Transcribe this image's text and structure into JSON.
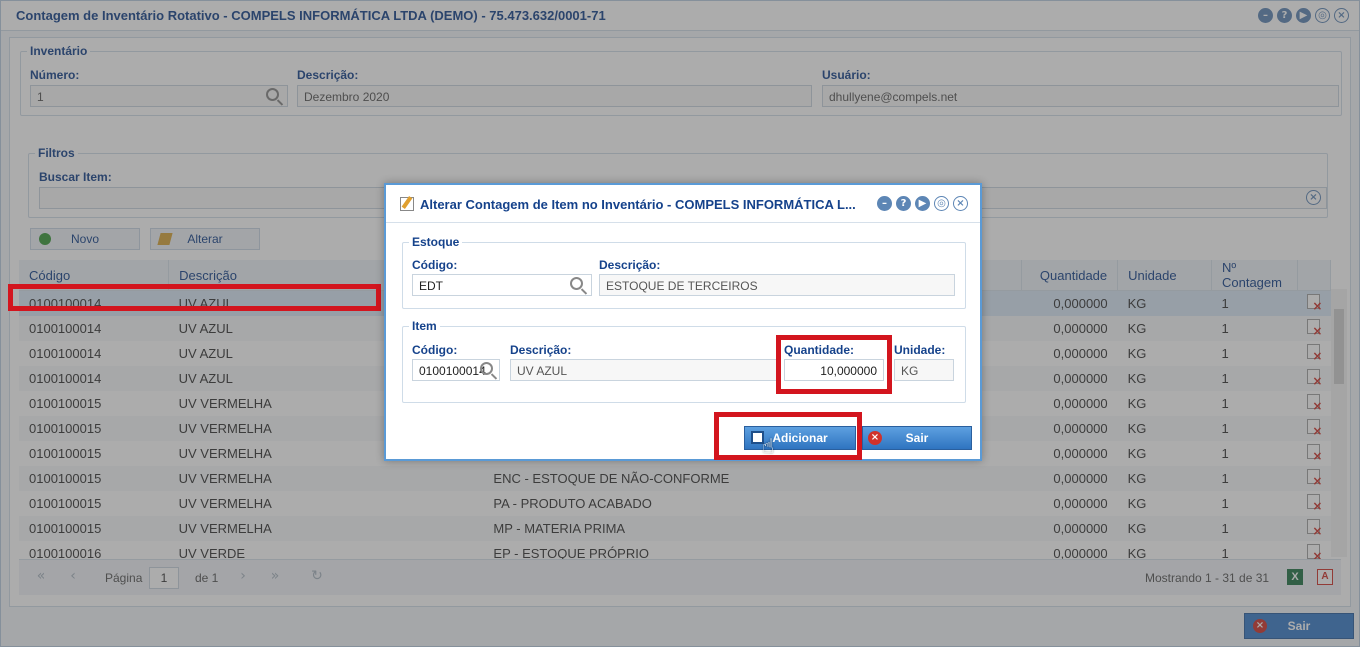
{
  "window": {
    "title": "Contagem de Inventário Rotativo - COMPELS INFORMÁTICA LTDA (DEMO) - 75.473.632/0001-71"
  },
  "inventario": {
    "legend": "Inventário",
    "numero_label": "Número:",
    "numero_value": "1",
    "descricao_label": "Descrição:",
    "descricao_value": "Dezembro 2020",
    "usuario_label": "Usuário:",
    "usuario_value": "dhullyene@compels.net"
  },
  "filtros": {
    "legend": "Filtros",
    "buscar_label": "Buscar Item:",
    "buscar_value": ""
  },
  "toolbar": {
    "novo_label": "Novo",
    "alterar_label": "Alterar"
  },
  "grid": {
    "columns": [
      "Código",
      "Descrição",
      "Quantidade",
      "Unidade",
      "Nº Contagem"
    ],
    "rows": [
      {
        "codigo": "0100100014",
        "descricao": "UV AZUL",
        "estoque": "",
        "quantidade": "0,000000",
        "unidade": "KG",
        "contagem": "1"
      },
      {
        "codigo": "0100100014",
        "descricao": "UV AZUL",
        "estoque": "",
        "quantidade": "0,000000",
        "unidade": "KG",
        "contagem": "1"
      },
      {
        "codigo": "0100100014",
        "descricao": "UV AZUL",
        "estoque": "",
        "quantidade": "0,000000",
        "unidade": "KG",
        "contagem": "1"
      },
      {
        "codigo": "0100100014",
        "descricao": "UV AZUL",
        "estoque": "",
        "quantidade": "0,000000",
        "unidade": "KG",
        "contagem": "1"
      },
      {
        "codigo": "0100100015",
        "descricao": "UV VERMELHA",
        "estoque": "",
        "quantidade": "0,000000",
        "unidade": "KG",
        "contagem": "1"
      },
      {
        "codigo": "0100100015",
        "descricao": "UV VERMELHA",
        "estoque": "",
        "quantidade": "0,000000",
        "unidade": "KG",
        "contagem": "1"
      },
      {
        "codigo": "0100100015",
        "descricao": "UV VERMELHA",
        "estoque": "",
        "quantidade": "0,000000",
        "unidade": "KG",
        "contagem": "1"
      },
      {
        "codigo": "0100100015",
        "descricao": "UV VERMELHA",
        "estoque": "ENC - ESTOQUE DE NÃO-CONFORME",
        "quantidade": "0,000000",
        "unidade": "KG",
        "contagem": "1"
      },
      {
        "codigo": "0100100015",
        "descricao": "UV VERMELHA",
        "estoque": "PA - PRODUTO ACABADO",
        "quantidade": "0,000000",
        "unidade": "KG",
        "contagem": "1"
      },
      {
        "codigo": "0100100015",
        "descricao": "UV VERMELHA",
        "estoque": "MP - MATERIA PRIMA",
        "quantidade": "0,000000",
        "unidade": "KG",
        "contagem": "1"
      },
      {
        "codigo": "0100100016",
        "descricao": "UV VERDE",
        "estoque": "EP - ESTOQUE PRÓPRIO",
        "quantidade": "0,000000",
        "unidade": "KG",
        "contagem": "1"
      }
    ]
  },
  "pager": {
    "page_label": "Página",
    "page_value": "1",
    "of_label": "de 1",
    "showing": "Mostrando 1 - 31 de 31"
  },
  "footer": {
    "sair_label": "Sair"
  },
  "modal": {
    "title": "Alterar Contagem de Item no Inventário - COMPELS INFORMÁTICA L...",
    "estoque": {
      "legend": "Estoque",
      "codigo_label": "Código:",
      "codigo_value": "EDT",
      "descricao_label": "Descrição:",
      "descricao_value": "ESTOQUE DE TERCEIROS"
    },
    "item": {
      "legend": "Item",
      "codigo_label": "Código:",
      "codigo_value": "0100100014",
      "descricao_label": "Descrição:",
      "descricao_value": "UV AZUL",
      "quantidade_label": "Quantidade:",
      "quantidade_value": "10,000000",
      "unidade_label": "Unidade:",
      "unidade_value": "KG"
    },
    "adicionar_label": "Adicionar",
    "sair_label": "Sair"
  },
  "colors": {
    "highlight": "#d3151e",
    "accent": "#15428b",
    "button": "#3a7cc9"
  }
}
